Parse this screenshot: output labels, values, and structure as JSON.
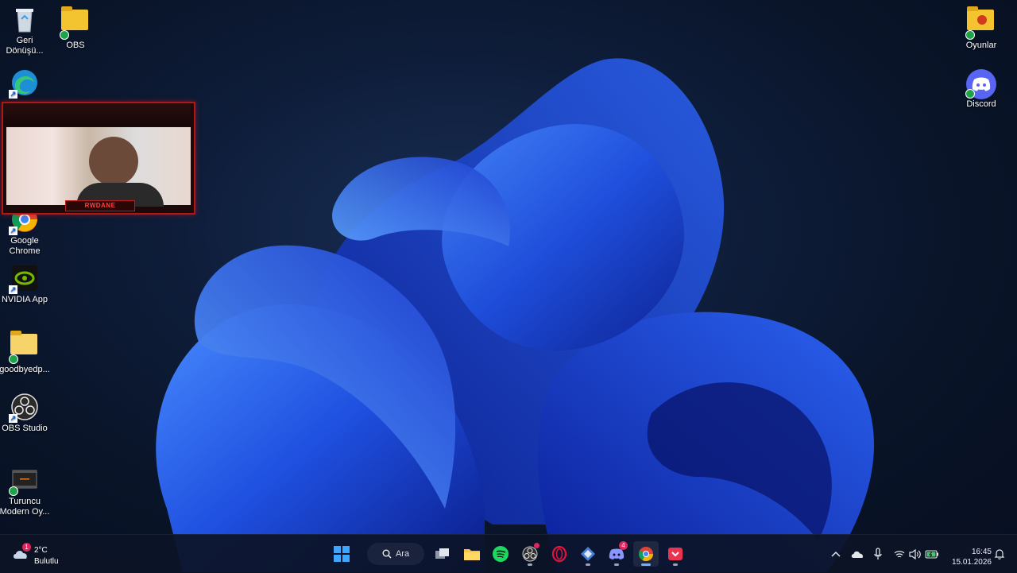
{
  "desktop": {
    "icons": [
      {
        "id": "recycle-bin",
        "label": "Geri Dönüşü..."
      },
      {
        "id": "obs-folder",
        "label": "OBS"
      },
      {
        "id": "edge",
        "label": ""
      },
      {
        "id": "chrome",
        "label": "Google Chrome"
      },
      {
        "id": "nvidia",
        "label": "NVIDIA App"
      },
      {
        "id": "goodbye-folder",
        "label": "goodbyedp..."
      },
      {
        "id": "obs-studio",
        "label": "OBS Studio"
      },
      {
        "id": "turuncu",
        "label": "Turuncu Modern Oy..."
      },
      {
        "id": "oyunlar",
        "label": "Oyunlar"
      },
      {
        "id": "discord",
        "label": "Discord"
      }
    ]
  },
  "webcam": {
    "nameplate": "RWDANE"
  },
  "taskbar": {
    "weather": {
      "temp": "2°C",
      "condition": "Bulutlu",
      "badge": "1"
    },
    "search_label": "Ara",
    "apps": [
      {
        "name": "start",
        "icon": "windows-icon"
      },
      {
        "name": "task-view",
        "icon": "task-view-icon"
      },
      {
        "name": "file-explorer",
        "icon": "folder-icon"
      },
      {
        "name": "spotify",
        "icon": "spotify-icon"
      },
      {
        "name": "obs",
        "icon": "obs-icon"
      },
      {
        "name": "opera-gx",
        "icon": "opera-icon"
      },
      {
        "name": "app-cube",
        "icon": "cube-icon"
      },
      {
        "name": "discord",
        "icon": "discord-icon",
        "badge": "4"
      },
      {
        "name": "chrome",
        "icon": "chrome-icon"
      },
      {
        "name": "pocket",
        "icon": "pocket-icon"
      }
    ],
    "clock": {
      "time": "16:45",
      "date": "15.01.2026"
    }
  },
  "colors": {
    "accent": "#3b6cff",
    "taskbar_bg": "#0c1426"
  }
}
